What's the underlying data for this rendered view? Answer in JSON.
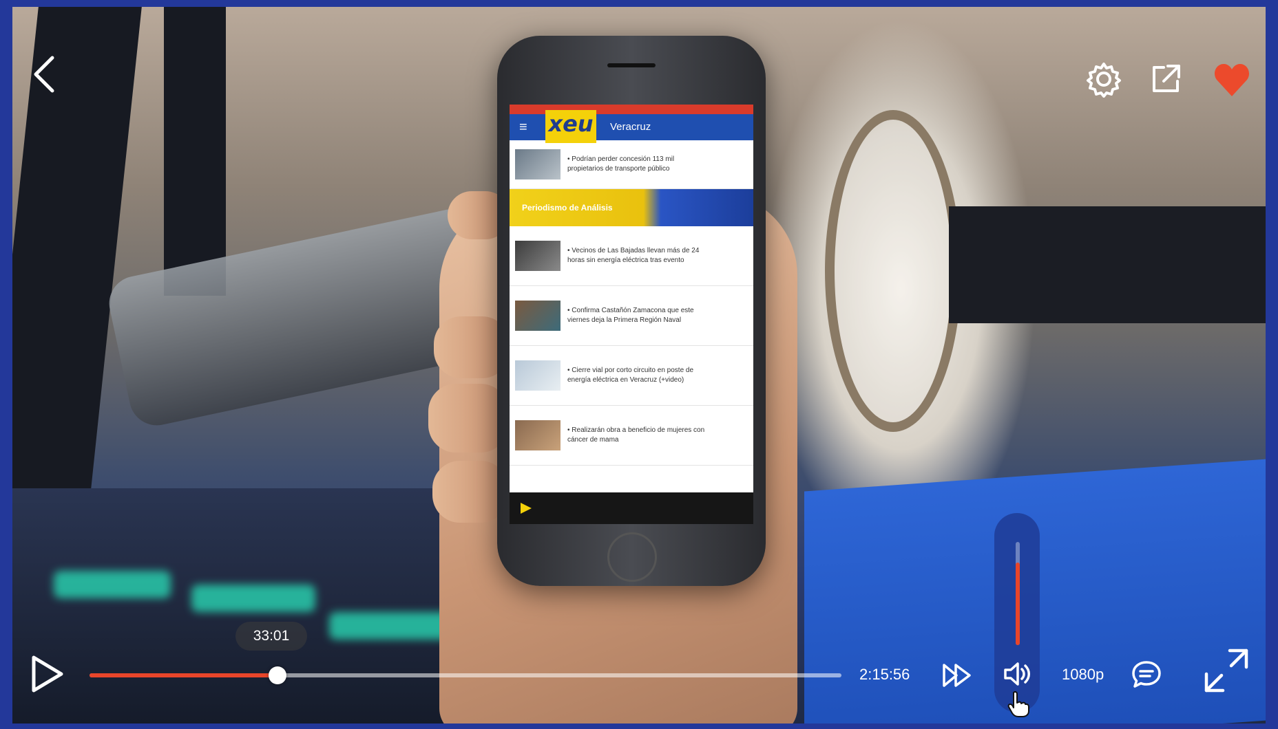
{
  "player": {
    "current_time_tip": "33:01",
    "duration": "2:15:56",
    "quality": "1080p",
    "progress_fraction": 0.25,
    "volume_fraction": 0.8,
    "favorited": true
  },
  "phone_app": {
    "logo": "xeu",
    "city": "Veracruz",
    "banner": "Periodismo de Análisis",
    "news": [
      "• Podrían perder concesión 113 mil propietarios de transporte público",
      "• Vecinos de Las Bajadas llevan más de 24 horas sin energía eléctrica tras evento",
      "• Confirma Castañón Zamacona que este viernes deja la Primera Región Naval",
      "• Cierre vial por corto circuito en poste de energía eléctrica en Veracruz (+video)",
      "• Realizarán obra a beneficio de mujeres con cáncer de mama"
    ]
  },
  "icons": {
    "back": "chevron-left-icon",
    "settings": "gear-icon",
    "share": "external-link-icon",
    "favorite": "heart-icon",
    "play": "play-icon",
    "fast_forward": "fast-forward-icon",
    "volume": "volume-icon",
    "captions": "caption-bubble-icon",
    "fullscreen": "expand-icon",
    "cursor": "hand-pointer-icon"
  },
  "colors": {
    "accent": "#e8452a",
    "frame": "#23389a",
    "heart": "#ec4a2c",
    "volume_panel": "#1e3c96"
  }
}
